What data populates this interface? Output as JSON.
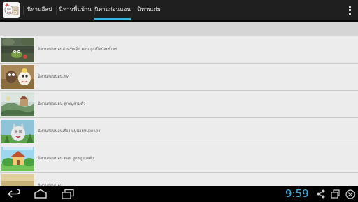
{
  "tabs": [
    {
      "label": "นิทานอีสป",
      "selected": false
    },
    {
      "label": "นิทานพื้นบ้าน",
      "selected": false
    },
    {
      "label": "นิทานก่อนนอน",
      "selected": true
    },
    {
      "label": "นิทานเก่ม",
      "selected": false
    }
  ],
  "list": {
    "items": [
      {
        "title": "นิทานก่อนนอนสำหรับเด็ก ตอน ลูกเป็ดน้อยขี้เหร่",
        "thumb": "frog-in-forest"
      },
      {
        "title": "นิทานก่อนนอน.flv",
        "thumb": "cartoon-characters"
      },
      {
        "title": "นิทานก่อนนอน ลูกหมูสามตัว",
        "thumb": "illustrated-landscape"
      },
      {
        "title": "นิทานก่อนนอนเรื่อง หนูน้อยหมวกแดง",
        "thumb": "cartoon-cat"
      },
      {
        "title": "นิทานก่อนนอน ตอน ลูกหมูสามตัว",
        "thumb": "farm-house"
      },
      {
        "title": "นิทานก่อนนอน ...",
        "thumb": "partial"
      }
    ]
  },
  "status": {
    "clock": "9:59"
  },
  "colors": {
    "accent": "#33b5e5",
    "actionbar": "#1f1f1f",
    "list_bg": "#ececec"
  }
}
